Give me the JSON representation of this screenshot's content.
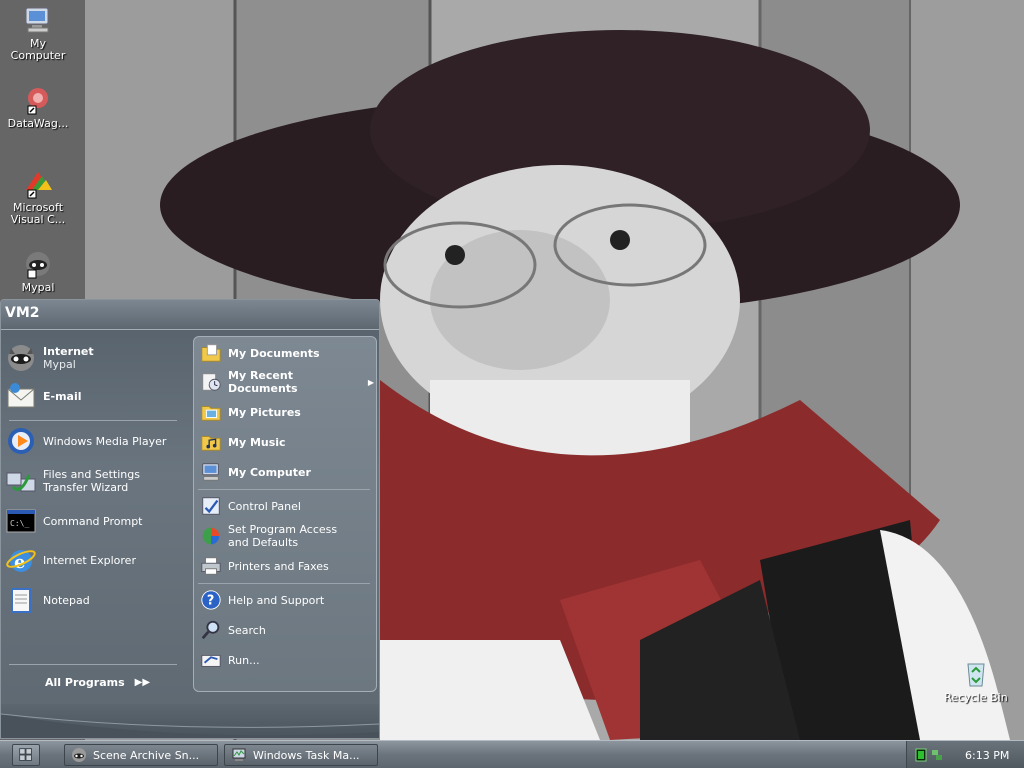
{
  "desktop": {
    "icons": [
      {
        "label": "My\nComputer",
        "icon": "my-computer-icon"
      },
      {
        "label": "DataWag...",
        "icon": "datawag-shortcut-icon"
      },
      {
        "label": "Microsoft\nVisual C...",
        "icon": "visual-c-shortcut-icon"
      },
      {
        "label": "Mypal",
        "icon": "mypal-shortcut-icon"
      },
      {
        "label": "Recycle Bin",
        "icon": "recycle-bin-icon"
      }
    ]
  },
  "start_menu": {
    "user": "VM2",
    "left_items": [
      {
        "title": "Internet",
        "subtitle": "Mypal",
        "icon": "mypal-icon"
      },
      {
        "title": "E-mail",
        "subtitle": "",
        "icon": "email-icon"
      },
      {
        "title": "Windows Media Player",
        "icon": "media-player-icon"
      },
      {
        "title": "Files and Settings\nTransfer Wizard",
        "icon": "transfer-wizard-icon"
      },
      {
        "title": "Command Prompt",
        "icon": "command-prompt-icon"
      },
      {
        "title": "Internet Explorer",
        "icon": "internet-explorer-icon"
      },
      {
        "title": "Notepad",
        "icon": "notepad-icon"
      }
    ],
    "all_programs": "All Programs",
    "right_items": [
      {
        "title": "My Documents",
        "icon": "my-documents-icon"
      },
      {
        "title": "My Recent\nDocuments",
        "icon": "recent-documents-icon"
      },
      {
        "title": "My Pictures",
        "icon": "my-pictures-icon"
      },
      {
        "title": "My Music",
        "icon": "my-music-icon"
      },
      {
        "title": "My Computer",
        "icon": "my-computer-icon"
      },
      {
        "title": "Control Panel",
        "icon": "control-panel-icon"
      },
      {
        "title": "Set Program Access\nand Defaults",
        "icon": "program-access-icon"
      },
      {
        "title": "Printers and Faxes",
        "icon": "printer-icon"
      },
      {
        "title": "Help and Support",
        "icon": "help-icon"
      },
      {
        "title": "Search",
        "icon": "search-icon"
      },
      {
        "title": "Run...",
        "icon": "run-icon"
      }
    ]
  },
  "taskbar": {
    "tasks": [
      {
        "label": "Scene Archive Sn...",
        "icon": "mypal-icon"
      },
      {
        "label": "Windows Task Ma...",
        "icon": "task-manager-icon"
      }
    ],
    "clock": "6:13 PM"
  },
  "colors": {
    "menu_bg": "#5e6871",
    "menu_accent": "#a4aeb6"
  }
}
